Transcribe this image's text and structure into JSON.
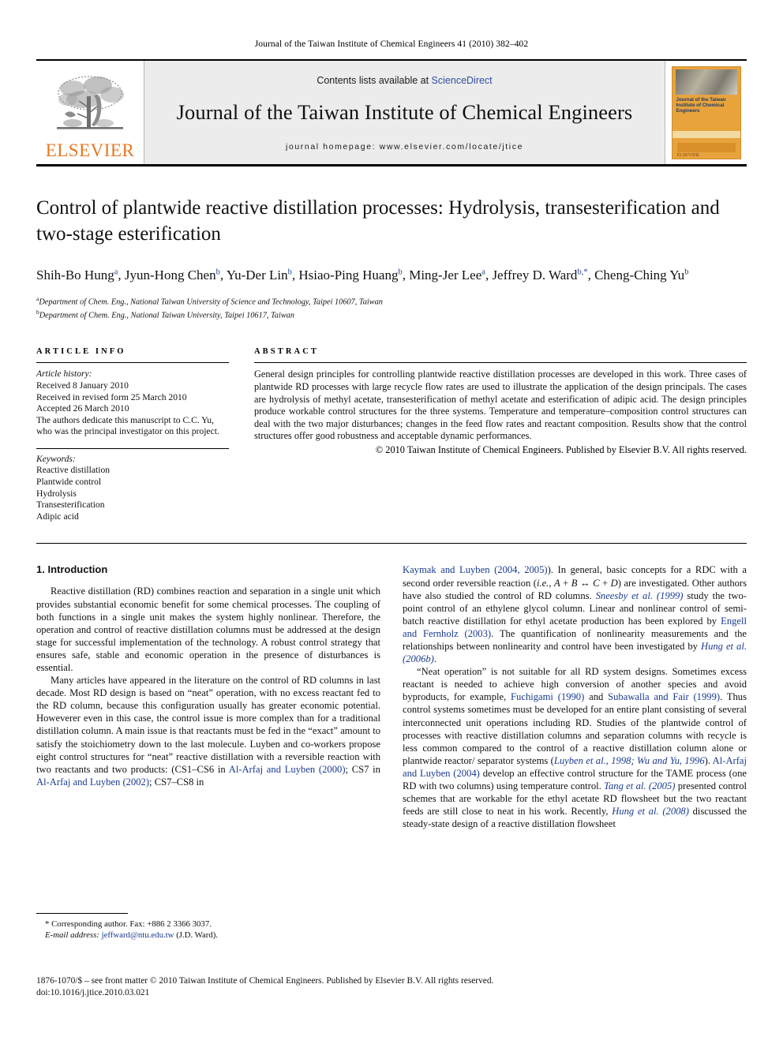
{
  "running_head": "Journal of the Taiwan Institute of Chemical Engineers 41 (2010) 382–402",
  "masthead": {
    "contents_prefix": "Contents lists available at ",
    "sciencedirect": "ScienceDirect",
    "journal_title": "Journal of the Taiwan Institute of Chemical Engineers",
    "homepage": "journal homepage: www.elsevier.com/locate/jtice",
    "publisher_logo_text": "ELSEVIER",
    "cover_title": "Journal of the Taiwan Institute of Chemical Engineers",
    "cover_publisher": "ELSEVIER",
    "accent_orange": "#E87722",
    "link_blue": "#2f4f9f",
    "panel_gray": "#ececec"
  },
  "article": {
    "title": "Control of plantwide reactive distillation processes: Hydrolysis, transesterification and two-stage esterification",
    "authors": [
      {
        "name": "Shih-Bo Hung",
        "sup": "a",
        "sep": ", "
      },
      {
        "name": "Jyun-Hong Chen",
        "sup": "b",
        "sep": ", "
      },
      {
        "name": "Yu-Der Lin",
        "sup": "b",
        "sep": ", "
      },
      {
        "name": "Hsiao-Ping Huang",
        "sup": "b",
        "sep": ", "
      },
      {
        "name": "Ming-Jer Lee",
        "sup": "a",
        "sep": ", "
      },
      {
        "name": "Jeffrey D. Ward",
        "sup": "b,*",
        "sep": ", "
      },
      {
        "name": "Cheng-Ching Yu",
        "sup": "b",
        "sep": ""
      }
    ],
    "affiliations": [
      {
        "sup": "a",
        "text": "Department of Chem. Eng., National Taiwan University of Science and Technology, Taipei 10607, Taiwan"
      },
      {
        "sup": "b",
        "text": "Department of Chem. Eng., National Taiwan University, Taipei 10617, Taiwan"
      }
    ]
  },
  "article_info": {
    "heading": "ARTICLE INFO",
    "history_label": "Article history:",
    "history": [
      "Received 8 January 2010",
      "Received in revised form 25 March 2010",
      "Accepted 26 March 2010",
      "The authors dedicate this manuscript to C.C. Yu, who was the principal investigator on this project."
    ],
    "keywords_label": "Keywords:",
    "keywords": [
      "Reactive distillation",
      "Plantwide control",
      "Hydrolysis",
      "Transesterification",
      "Adipic acid"
    ]
  },
  "abstract": {
    "heading": "ABSTRACT",
    "text": "General design principles for controlling plantwide reactive distillation processes are developed in this work. Three cases of plantwide RD processes with large recycle flow rates are used to illustrate the application of the design principals. The cases are hydrolysis of methyl acetate, transesterification of methyl acetate and esterification of adipic acid. The design principles produce workable control structures for the three systems. Temperature and temperature–composition control structures can deal with the two major disturbances; changes in the feed flow rates and reactant composition. Results show that the control structures offer good robustness and acceptable dynamic performances.",
    "copyright": "© 2010 Taiwan Institute of Chemical Engineers. Published by Elsevier B.V. All rights reserved."
  },
  "body": {
    "section_title": "1. Introduction",
    "left_paragraphs": [
      "Reactive distillation (RD) combines reaction and separation in a single unit which provides substantial economic benefit for some chemical processes. The coupling of both functions in a single unit makes the system highly nonlinear. Therefore, the operation and control of reactive distillation columns must be addressed at the design stage for successful implementation of the technology. A robust control strategy that ensures safe, stable and economic operation in the presence of disturbances is essential.",
      "Many articles have appeared in the literature on the control of RD columns in last decade. Most RD design is based on “neat” operation, with no excess reactant fed to the RD column, because this configuration usually has greater economic potential. However even in this case, the control issue is more complex than for a traditional distillation column. A main issue is that reactants must be fed in the “exact” amount to satisfy the stoichiometry down to the last molecule. Luyben and co-workers propose eight control structures for “neat” reactive distillation with a reversible reaction with two reactants and two products: (CS1–CS6 in Al-Arfaj and Luyben (2000); CS7 in Al-Arfaj and Luyben (2002); CS7–CS8 in"
    ],
    "right_paragraphs": [
      "Kaymak and Luyben (2004, 2005)). In general, basic concepts for a RDC with a second order reversible reaction (i.e., A + B ↔ C + D) are investigated. Other authors have also studied the control of RD columns. Sneesby et al. (1999) study the two-point control of an ethylene glycol column. Linear and nonlinear control of semi-batch reactive distillation for ethyl acetate production has been explored by Engell and Fernholz (2003). The quantification of nonlinearity measurements and the relationships between nonlinearity and control have been investigated by Hung et al. (2006b).",
      "“Neat operation” is not suitable for all RD system designs. Sometimes excess reactant is needed to achieve high conversion of another species and avoid byproducts, for example, Fuchigami (1990) and Subawalla and Fair (1999). Thus control systems sometimes must be developed for an entire plant consisting of several interconnected unit operations including RD. Studies of the plantwide control of processes with reactive distillation columns and separation columns with recycle is less common compared to the control of a reactive distillation column alone or plantwide reactor/separator systems (Luyben et al., 1998; Wu and Yu, 1996). Al-Arfaj and Luyben (2004) develop an effective control structure for the TAME process (one RD with two columns) using temperature control. Tang et al. (2005) presented control schemes that are workable for the ethyl acetate RD flowsheet but the two reactant feeds are still close to neat in his work. Recently, Hung et al. (2008) discussed the steady-state design of a reactive distillation flowsheet"
    ]
  },
  "footnote": {
    "corresponding": "* Corresponding author. Fax: +886 2 3366 3037.",
    "email_label": "E-mail address:",
    "email": "jeffward@ntu.edu.tw",
    "email_owner": "(J.D. Ward)."
  },
  "footer": {
    "issn_line": "1876-1070/$ – see front matter © 2010 Taiwan Institute of Chemical Engineers. Published by Elsevier B.V. All rights reserved.",
    "doi_line": "doi:10.1016/j.jtice.2010.03.021"
  }
}
